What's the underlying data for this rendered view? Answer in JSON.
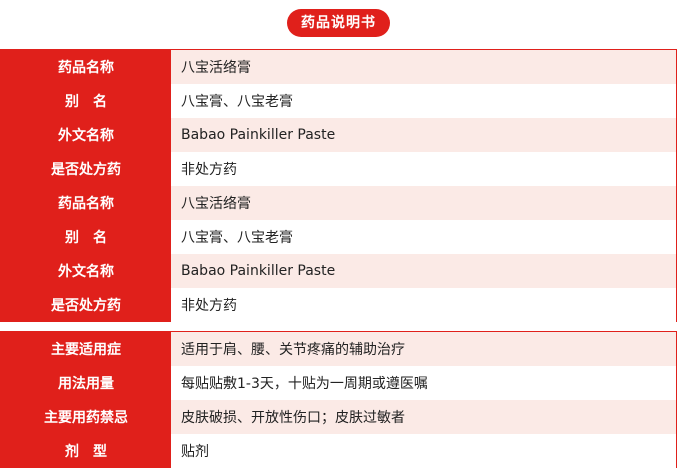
{
  "title": "药品说明书",
  "section1": [
    {
      "label": "药品名称",
      "value": "八宝活络膏"
    },
    {
      "label": "别　名",
      "value": "八宝膏、八宝老膏"
    },
    {
      "label": "外文名称",
      "value": "Babao Painkiller Paste"
    },
    {
      "label": "是否处方药",
      "value": "非处方药"
    },
    {
      "label": "药品名称",
      "value": "八宝活络膏"
    },
    {
      "label": "别　名",
      "value": "八宝膏、八宝老膏"
    },
    {
      "label": "外文名称",
      "value": "Babao Painkiller Paste"
    },
    {
      "label": "是否处方药",
      "value": "非处方药"
    }
  ],
  "section2": [
    {
      "label": "主要适用症",
      "value": "适用于肩、腰、关节疼痛的辅助治疗"
    },
    {
      "label": "用法用量",
      "value": "每贴贴敷1-3天，十贴为一周期或遵医嘱"
    },
    {
      "label": "主要用药禁忌",
      "value": "皮肤破损、开放性伤口；皮肤过敏者"
    },
    {
      "label": "剂　型",
      "value": "贴剂"
    }
  ],
  "colors": {
    "accent": "#e0201b",
    "row_tint": "#fbeae6"
  }
}
